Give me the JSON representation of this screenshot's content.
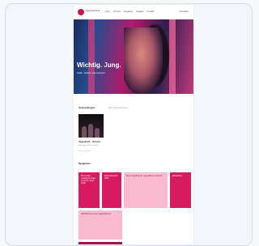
{
  "header": {
    "logo_text": "Jugendverband",
    "nav": [
      {
        "label": "Start",
        "active": true
      },
      {
        "label": "Themen",
        "active": false
      },
      {
        "label": "Angebote",
        "active": false
      },
      {
        "label": "Projekte",
        "active": false
      },
      {
        "label": "Kontakt",
        "active": false
      }
    ],
    "account": "Anmelden"
  },
  "hero": {
    "title": "Wichtig. Jung.",
    "subtitle": "Stark. Selbst. Gemeinsam."
  },
  "events": {
    "heading": "Veranstaltungen",
    "link": "Alle Veranstaltungen",
    "item": {
      "title": "Jugendtreff – Konzert",
      "meta": "Samstag, 14.10., 19 Uhr",
      "meta2": "Gemeindehaus"
    }
  },
  "news": {
    "heading": "Neuigkeiten",
    "cards": [
      {
        "text": "Wir suchen engagierte junge Leute für unser Team",
        "style": "magenta"
      },
      {
        "text": "Sommerfreizeit 2023",
        "style": "magenta"
      },
      {
        "text": "Neue Angebote für Jugendliche im Herbst",
        "style": "pink"
      },
      {
        "text": "Mitmachen",
        "style": "magenta"
      },
      {
        "text": "Rückblick auf unser Jugendfestival",
        "style": "pink"
      }
    ]
  },
  "colors": {
    "accent": "#d81b60",
    "light": "#f8bbd0"
  }
}
